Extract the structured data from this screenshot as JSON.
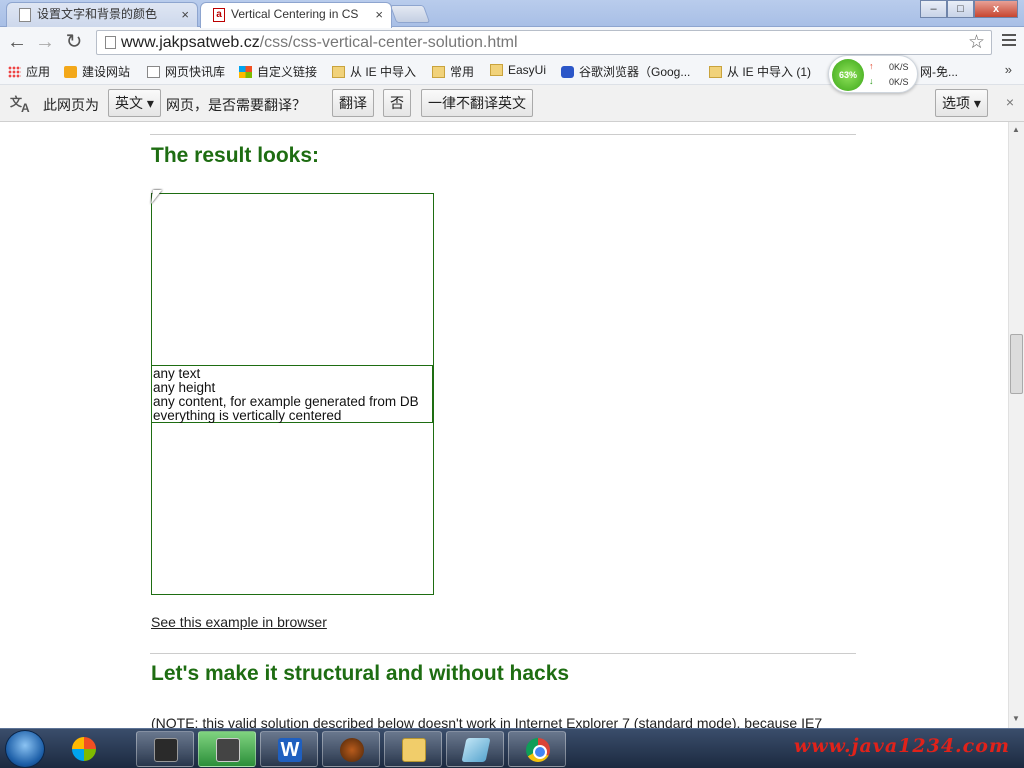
{
  "tabs": [
    {
      "label": "设置文字和背景的颜色",
      "close": "×"
    },
    {
      "label": "Vertical Centering in CS",
      "close": "×",
      "icon": "a"
    }
  ],
  "window_controls": {
    "minimize": "–",
    "maximize": "□",
    "close": "x"
  },
  "toolbar": {
    "back": "←",
    "forward": "→",
    "reload": "↻",
    "url_host": "www.jakpsatweb.cz",
    "url_path": "/css/css-vertical-center-solution.html",
    "star": "☆"
  },
  "bookmarks": {
    "items": [
      {
        "label": "应用",
        "icon": "apps-icon"
      },
      {
        "label": "建设网站",
        "icon": "bulb-icon"
      },
      {
        "label": "网页快讯库",
        "icon": "page-icon"
      },
      {
        "label": "自定义链接",
        "icon": "windows-icon"
      },
      {
        "label": "从 IE 中导入",
        "icon": "folder-icon"
      },
      {
        "label": "常用",
        "icon": "folder-icon"
      },
      {
        "label": "EasyUi",
        "icon": "folder-icon"
      },
      {
        "label": "谷歌浏览器（Goog...",
        "icon": "paw-icon"
      },
      {
        "label": "从 IE 中导入 (1)",
        "icon": "folder-icon"
      },
      {
        "label": "网-免...",
        "icon": "none"
      }
    ],
    "more": "»"
  },
  "speed_widget": {
    "percent": "63%",
    "up_arrow": "↑",
    "down_arrow": "↓",
    "up": "0K/S",
    "down": "0K/S"
  },
  "translate_bar": {
    "prefix": "此网页为",
    "language": "英文 ▾",
    "suffix": "网页，是否需要翻译？",
    "translate_button": "翻译",
    "no_button": "否",
    "never_button": "一律不翻译英文",
    "options_button": "选项 ▾",
    "close": "×"
  },
  "content": {
    "heading_result": "The result looks:",
    "box_lines": [
      "any text",
      "any height",
      "any content, for example generated from DB",
      "everything is vertically centered"
    ],
    "example_link": "See this example in browser",
    "heading_structural": "Let's make it structural and without hacks",
    "note": "(NOTE: this valid solution described below doesn't work in Internet Explorer 7 (standard mode), because IE7"
  },
  "scrollbar": {
    "up": "▲",
    "down": "▼"
  },
  "taskbar": {
    "apps": [
      "terminal",
      "app-green",
      "word",
      "java-ee-ide",
      "explorer",
      "notepad",
      "chrome"
    ],
    "word_label": "W",
    "watermark": "www.java1234.com"
  },
  "colors": {
    "heading": "#1e6d12",
    "box_border": "#1e6d12",
    "accent": "#e0221a"
  }
}
